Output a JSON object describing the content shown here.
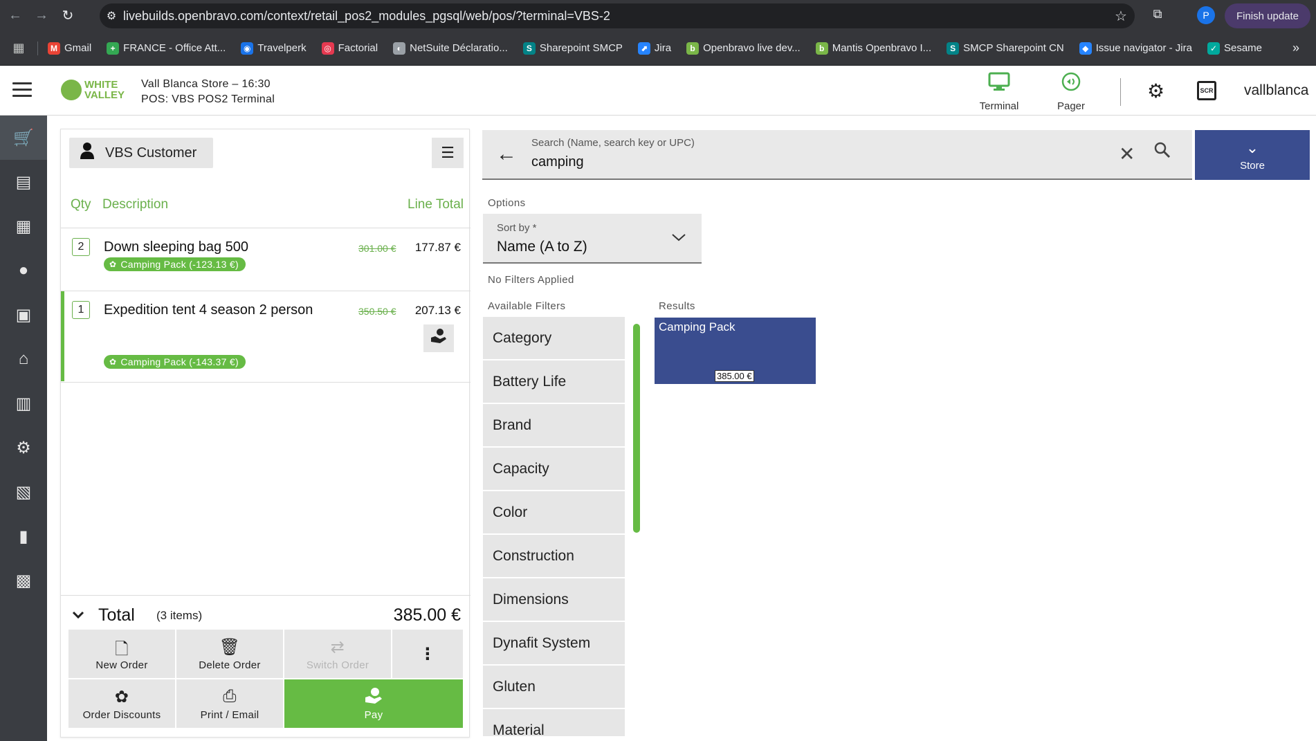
{
  "browser": {
    "url": "livebuilds.openbravo.com/context/retail_pos2_modules_pgsql/web/pos/?terminal=VBS-2",
    "profile_initial": "P",
    "finish_update_label": "Finish update"
  },
  "bookmarks": [
    {
      "label": "Gmail",
      "color": "#ea4335",
      "glyph": "M"
    },
    {
      "label": "FRANCE - Office Att...",
      "color": "#34a853",
      "glyph": "+"
    },
    {
      "label": "Travelperk",
      "color": "#1a73e8",
      "glyph": "◉"
    },
    {
      "label": "Factorial",
      "color": "#e53950",
      "glyph": "◎"
    },
    {
      "label": "NetSuite Déclaratio...",
      "color": "#9aa0a6",
      "glyph": "◐"
    },
    {
      "label": "Sharepoint SMCP",
      "color": "#038387",
      "glyph": "S"
    },
    {
      "label": "Jira",
      "color": "#2684ff",
      "glyph": "⬈"
    },
    {
      "label": "Openbravo live dev...",
      "color": "#7ab648",
      "glyph": "b"
    },
    {
      "label": "Mantis Openbravo I...",
      "color": "#7ab648",
      "glyph": "b"
    },
    {
      "label": "SMCP Sharepoint CN",
      "color": "#038387",
      "glyph": "S"
    },
    {
      "label": "Issue navigator - Jira",
      "color": "#2684ff",
      "glyph": "◆"
    },
    {
      "label": "Sesame",
      "color": "#00a99d",
      "glyph": "✓"
    }
  ],
  "header": {
    "logo_line1": "WHITE",
    "logo_line2": "VALLEY",
    "store_line": "Vall Blanca Store – 16:30",
    "pos_line": "POS: VBS POS2 Terminal",
    "terminal_label": "Terminal",
    "pager_label": "Pager",
    "username": "vallblanca",
    "accent_color": "#66bb44"
  },
  "ticket": {
    "customer": "VBS Customer",
    "col_qty": "Qty",
    "col_desc": "Description",
    "col_total": "Line Total",
    "lines": [
      {
        "qty": "2",
        "description": "Down sleeping bag 500",
        "old_price": "301.00 €",
        "line_total": "177.87 €",
        "discount": "Camping Pack (-123.13 €)"
      },
      {
        "qty": "1",
        "description": "Expedition tent 4 season 2 person",
        "old_price": "350.50 €",
        "line_total": "207.13 €",
        "discount": "Camping Pack (-143.37 €)"
      }
    ],
    "total_label": "Total",
    "total_items": "(3 items)",
    "total_value": "385.00 €"
  },
  "actions": {
    "new_order": "New Order",
    "delete_order": "Delete Order",
    "switch_order": "Switch Order",
    "order_discounts": "Order Discounts",
    "print_email": "Print / Email",
    "pay": "Pay"
  },
  "search": {
    "label": "Search (Name, search key or UPC)",
    "value": "camping",
    "store_label": "Store"
  },
  "options": {
    "label": "Options",
    "sort_label": "Sort by *",
    "sort_value": "Name (A to Z)",
    "no_filters": "No Filters Applied",
    "available_filters_label": "Available Filters",
    "results_label": "Results",
    "filters": [
      "Category",
      "Battery Life",
      "Brand",
      "Capacity",
      "Color",
      "Construction",
      "Dimensions",
      "Dynafit System",
      "Gluten",
      "Material"
    ]
  },
  "results": [
    {
      "name": "Camping Pack",
      "price": "385.00 €"
    }
  ]
}
